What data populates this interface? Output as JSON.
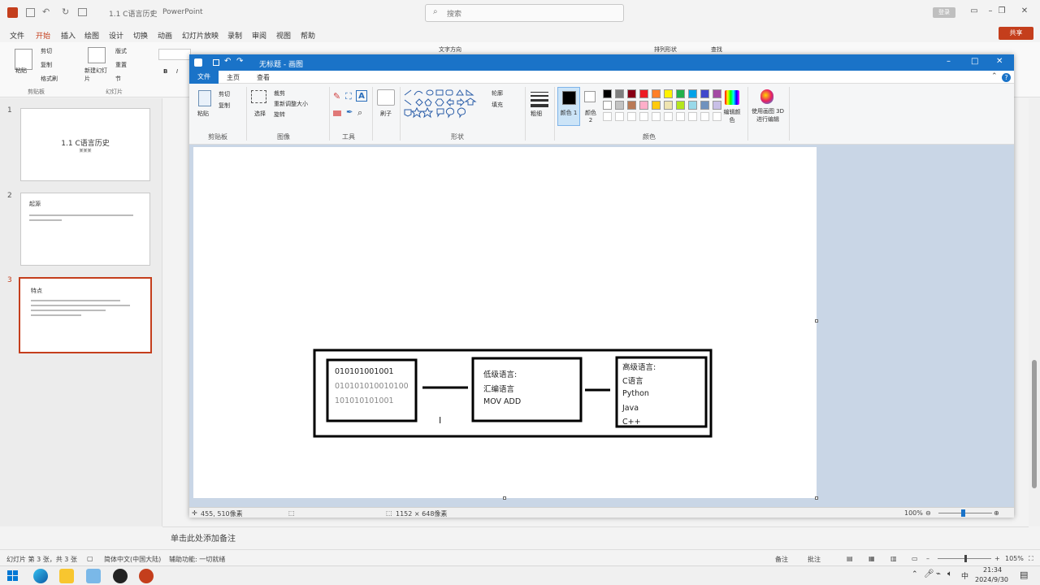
{
  "pp": {
    "doc_title": "1.1 C语言历史",
    "app_name": "PowerPoint",
    "search_placeholder": "搜索",
    "user_label": "登录",
    "share_label": "共享",
    "menu": [
      "文件",
      "开始",
      "插入",
      "绘图",
      "设计",
      "切换",
      "动画",
      "幻灯片放映",
      "录制",
      "审阅",
      "视图",
      "帮助"
    ],
    "ribbon": {
      "paste": "粘贴",
      "cut": "剪切",
      "copy": "复制",
      "format_painter": "格式刷",
      "clipboard_group": "剪贴板",
      "new_slide": "新建幻灯片",
      "layout": "版式",
      "reset": "重置",
      "section": "节",
      "slides_group": "幻灯片",
      "text_direction": "文字方向",
      "arrange": "排列形状",
      "find": "查找"
    },
    "slides": [
      {
        "num": "1",
        "title": "1.1 C语言历史",
        "sub": "某某某"
      },
      {
        "num": "2",
        "title": "起源"
      },
      {
        "num": "3",
        "title": "特点"
      }
    ],
    "notes_placeholder": "单击此处添加备注",
    "status": {
      "slide_count": "幻灯片 第 3 张，共 3 张",
      "language": "简体中文(中国大陆)",
      "accessibility": "辅助功能: 一切就绪",
      "notes": "备注",
      "comments": "批注",
      "zoom": "105%"
    }
  },
  "paint": {
    "title": "无标题 - 画图",
    "tabs": {
      "file": "文件",
      "home": "主页",
      "view": "查看"
    },
    "ribbon": {
      "paste": "粘贴",
      "cut": "剪切",
      "copy": "复制",
      "clipboard": "剪贴板",
      "select": "选择",
      "crop": "裁剪",
      "resize": "重新调整大小",
      "rotate": "旋转",
      "image": "图像",
      "tools": "工具",
      "brush": "刷子",
      "shapes": "形状",
      "outline": "轮廓",
      "fill": "填充",
      "thickness": "粗细",
      "color1": "颜色 1",
      "color2": "颜色 2",
      "edit_colors": "编辑颜色",
      "paint3d": "使用画图 3D 进行编辑",
      "colors_group": "颜色"
    },
    "palette": [
      "#000000",
      "#7f7f7f",
      "#880015",
      "#ed1c24",
      "#ff7f27",
      "#fff200",
      "#22b14c",
      "#00a2e8",
      "#3f48cc",
      "#a349a4",
      "#ffffff",
      "#c3c3c3",
      "#b97a57",
      "#ffaec9",
      "#ffc90e",
      "#efe4b0",
      "#b5e61d",
      "#99d9ea",
      "#7092be",
      "#c8bfe7"
    ],
    "status": {
      "cursor": "455, 510像素",
      "size": "1152 × 648像素",
      "zoom": "100%"
    },
    "drawing": {
      "box1": [
        "010101001001",
        "010101010010100",
        "101010101001"
      ],
      "box2": [
        "低级语言:",
        "汇编语言",
        "MOV ADD"
      ],
      "box3": [
        "高级语言:",
        "C语言",
        "Python",
        "Java",
        "C++"
      ]
    }
  },
  "taskbar": {
    "time": "21:34",
    "date": "2024/9/30",
    "ime": "中"
  }
}
